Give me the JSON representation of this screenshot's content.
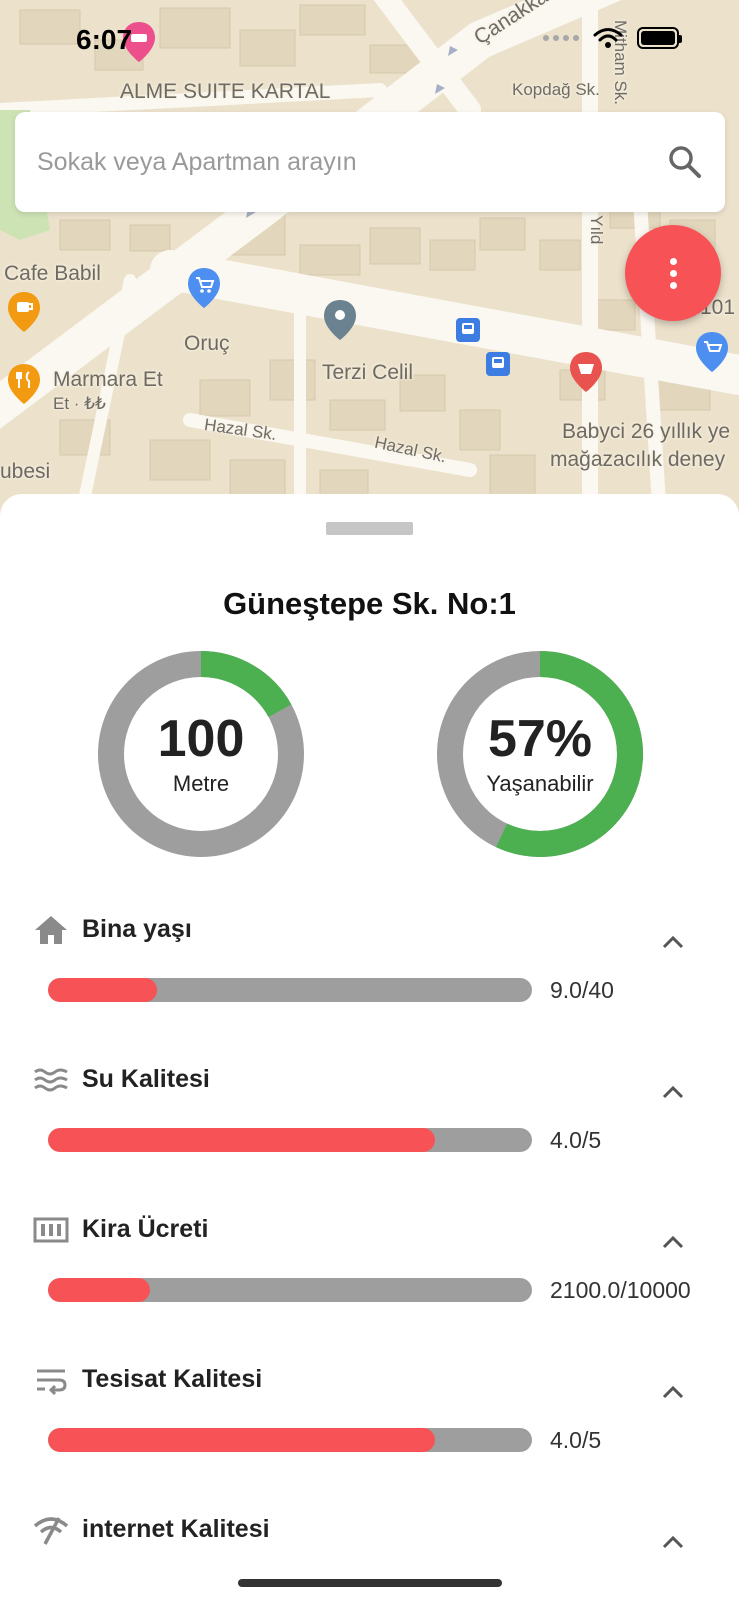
{
  "status_bar": {
    "time": "6:07"
  },
  "map": {
    "labels": {
      "hotel": "ALME SUITE KARTAL",
      "canakkale": "Çanakkale Cd.",
      "kopdag": "Kopdağ Sk.",
      "cafe_babil": "Cafe Babil",
      "oruc": "Oruç",
      "terzi_celil": "Terzi Celil",
      "marmara_et": "Marmara Et",
      "marmara_et_sub": "Et · ₺₺",
      "hazal_1": "Hazal Sk.",
      "hazal_2": "Hazal Sk.",
      "babyci_1": "Babyci 26 yıllık ye",
      "babyci_2": "mağazacılık deney",
      "subesi": "ubesi",
      "mithat": "Mitham Sk.",
      "yildiz": "Yıld",
      "num_101": "101"
    }
  },
  "search": {
    "placeholder": "Sokak veya Apartman arayın"
  },
  "address": {
    "title": "Güneştepe Sk. No:1"
  },
  "gauges": [
    {
      "value": "100",
      "caption": "Metre",
      "fraction": 0.17
    },
    {
      "value": "57%",
      "caption": "Yaşanabilir",
      "fraction": 0.57
    }
  ],
  "metrics": [
    {
      "icon": "home-icon",
      "label": "Bina yaşı",
      "value": "9.0/40",
      "fraction": 0.225
    },
    {
      "icon": "water-waves-icon",
      "label": "Su Kalitesi",
      "value": "4.0/5",
      "fraction": 0.8
    },
    {
      "icon": "money-bill-icon",
      "label": "Kira Ücreti",
      "value": "2100.0/10000",
      "fraction": 0.21
    },
    {
      "icon": "plumbing-wrap-icon",
      "label": "Tesisat Kalitesi",
      "value": "4.0/5",
      "fraction": 0.8
    },
    {
      "icon": "wifi-off-icon",
      "label": "internet Kalitesi",
      "value": "",
      "fraction": 0
    }
  ],
  "colors": {
    "accent_red": "#f75356",
    "gauge_green": "#4caf50",
    "track_gray": "#9e9e9e",
    "map_bg": "#ece2cc"
  }
}
